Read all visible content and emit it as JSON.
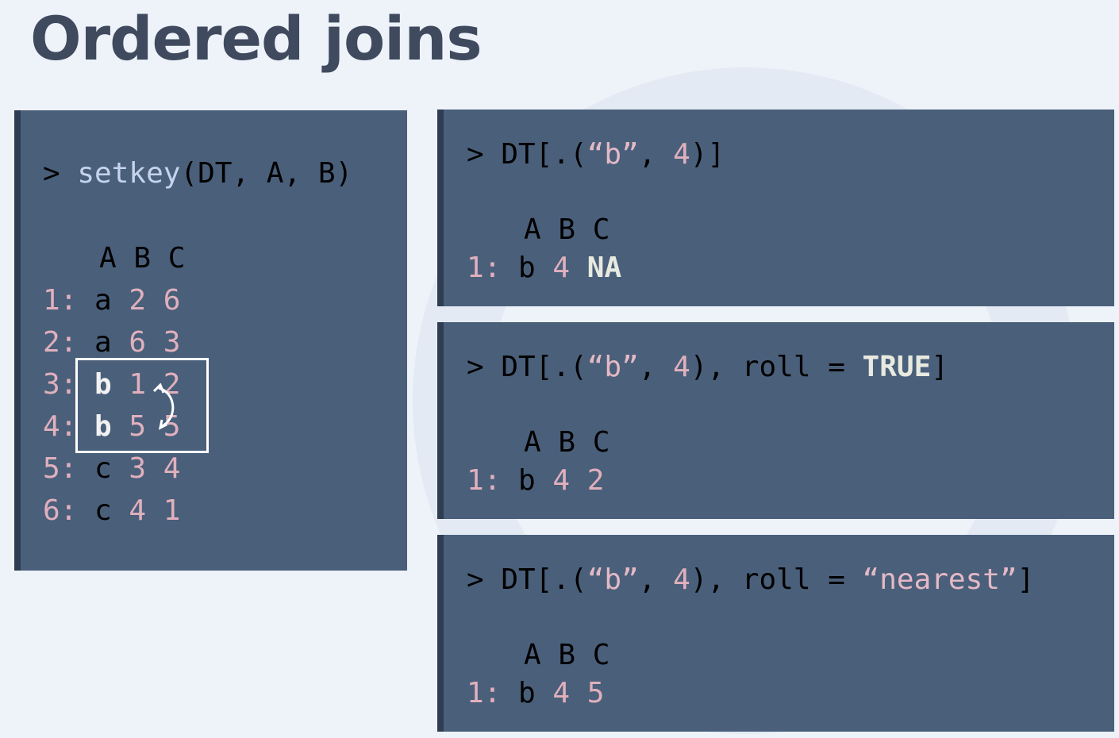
{
  "title": "Ordered joins",
  "left_panel": {
    "prompt": ">",
    "func": "setkey",
    "args": "(DT, A, B)",
    "header": "A B C",
    "rows": [
      {
        "idx": "1:",
        "a": "a",
        "b": "2",
        "c": "6"
      },
      {
        "idx": "2:",
        "a": "a",
        "b": "6",
        "c": "3"
      },
      {
        "idx": "3:",
        "a": "b",
        "b": "1",
        "c": "2"
      },
      {
        "idx": "4:",
        "a": "b",
        "b": "5",
        "c": "5"
      },
      {
        "idx": "5:",
        "a": "c",
        "b": "3",
        "c": "4"
      },
      {
        "idx": "6:",
        "a": "c",
        "b": "4",
        "c": "1"
      }
    ]
  },
  "panels": [
    {
      "cmd_pre": "> DT[.(",
      "str": "“b”",
      "sep": ", ",
      "num": "4",
      "post": ")]",
      "roll_kw": "",
      "roll_val": "",
      "roll_close": "",
      "header": "A B C",
      "row": {
        "idx": "1:",
        "a": "b",
        "b": "4",
        "c": "NA"
      }
    },
    {
      "cmd_pre": "> DT[.(",
      "str": "“b”",
      "sep": ", ",
      "num": "4",
      "post": "), roll = ",
      "roll_val": "TRUE",
      "roll_close": "]",
      "header": "A B C",
      "row": {
        "idx": "1:",
        "a": "b",
        "b": "4",
        "c": "2"
      }
    },
    {
      "cmd_pre": "> DT[.(",
      "str": "“b”",
      "sep": ", ",
      "num": "4",
      "post": "), roll = ",
      "roll_val": "“nearest”",
      "roll_close": "]",
      "header": "A B C",
      "row": {
        "idx": "1:",
        "a": "b",
        "b": "4",
        "c": "5"
      }
    }
  ]
}
